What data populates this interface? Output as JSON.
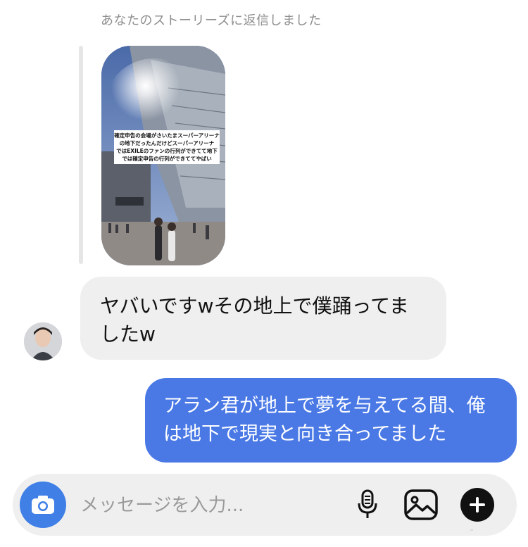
{
  "reply_note": "あなたのストーリーズに返信しました",
  "story": {
    "caption": "確定申告の会場がさいたまスーパーアリーナ\nの地下だったんだけどスーパーアリーナ\nではEXILEのファンの行列ができてて地下\nでは確定申告の行列ができててやばい"
  },
  "messages": {
    "incoming": "ヤバいですwその地上で僕踊ってましたw",
    "outgoing": "アラン君が地上で夢を与えてる間、俺は地下で現実と向き合ってました"
  },
  "composer": {
    "placeholder": "メッセージを入力..."
  },
  "icons": {
    "camera": "camera-icon",
    "mic": "microphone-icon",
    "gallery": "image-icon",
    "plus": "plus-icon"
  },
  "colors": {
    "outgoing_bubble": "#4a79e6",
    "incoming_bubble": "#efefef",
    "camera_button": "#3f7fe6"
  }
}
